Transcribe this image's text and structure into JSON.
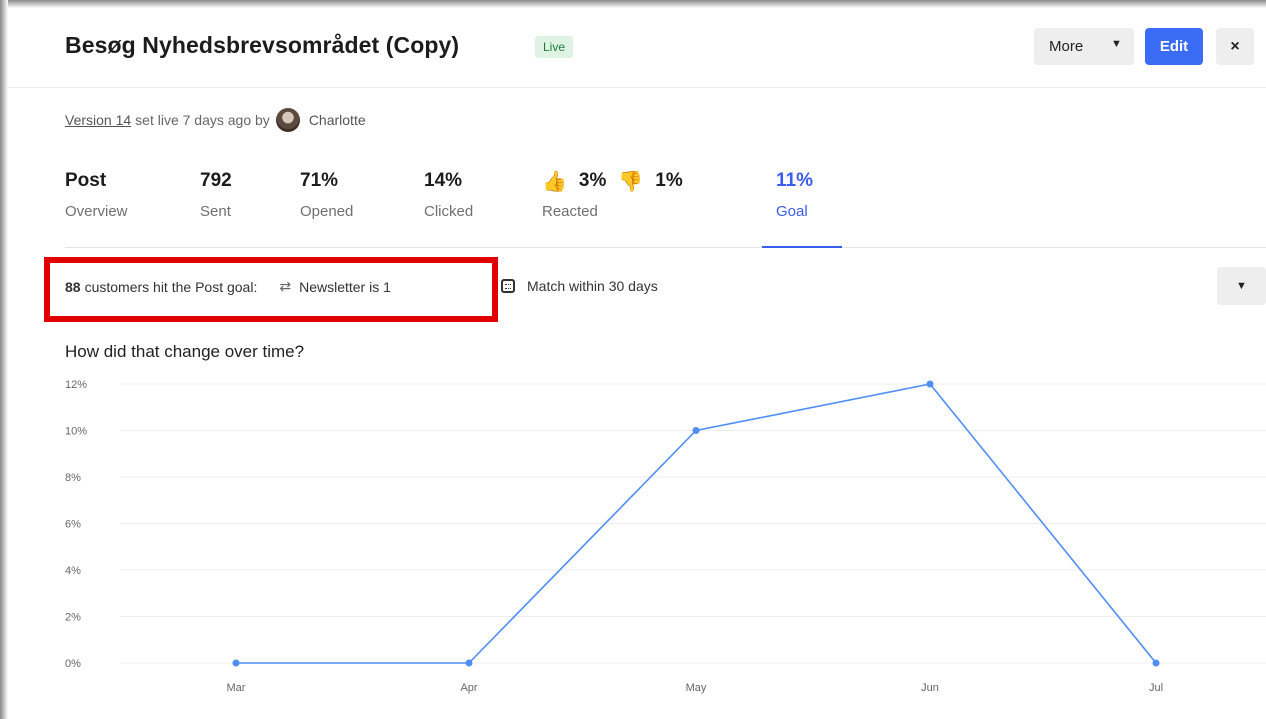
{
  "header": {
    "title": "Besøg Nyhedsbrevsområdet (Copy)",
    "status_badge": "Live",
    "more_label": "More",
    "edit_label": "Edit",
    "close_label": "×"
  },
  "version": {
    "link": "Version 14",
    "text": "set live 7 days ago by",
    "author": "Charlotte"
  },
  "tabs": [
    {
      "value": "Post",
      "caption": "Overview"
    },
    {
      "value": "792",
      "caption": "Sent"
    },
    {
      "value": "71%",
      "caption": "Opened"
    },
    {
      "value": "14%",
      "caption": "Clicked"
    },
    {
      "up": "3%",
      "down": "1%",
      "caption": "Reacted"
    },
    {
      "value": "11%",
      "caption": "Goal",
      "active": true
    }
  ],
  "goal": {
    "count": "88",
    "text": "customers hit the Post goal:",
    "condition": "Newsletter is 1",
    "match": "Match within 30 days"
  },
  "chart_title": "How did that change over time?",
  "colors": {
    "accent": "#3b6cf6",
    "line": "#4f8ef7",
    "highlight": "#e00000"
  },
  "chart_data": {
    "type": "line",
    "categories": [
      "Mar",
      "Apr",
      "May",
      "Jun",
      "Jul"
    ],
    "series": [
      {
        "values": [
          0,
          0,
          10,
          12,
          0
        ]
      }
    ],
    "yticks": [
      "0%",
      "2%",
      "4%",
      "6%",
      "8%",
      "10%",
      "12%"
    ],
    "ylim": [
      0,
      12
    ],
    "grid": true
  }
}
